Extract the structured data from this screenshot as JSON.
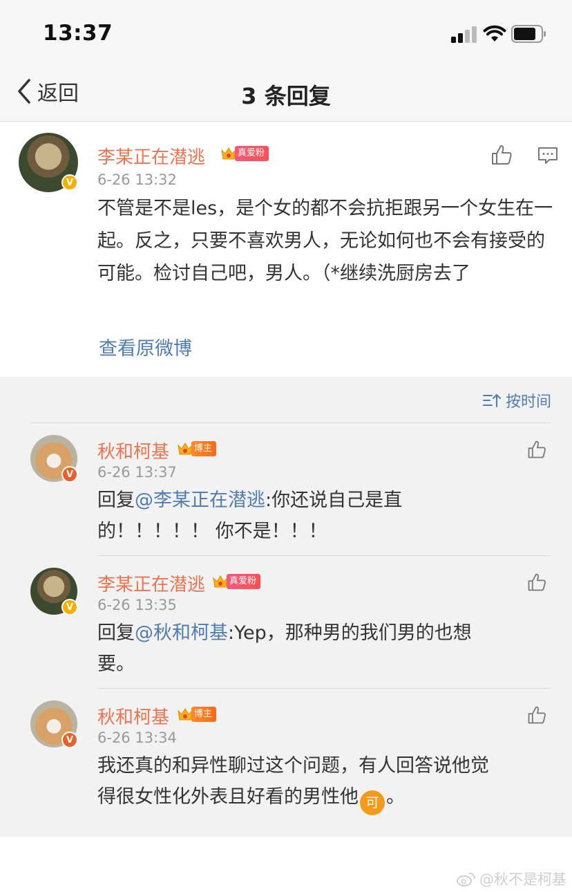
{
  "status_bar": {
    "time": "13:37"
  },
  "nav": {
    "back_label": "返回",
    "title": "3 条回复"
  },
  "main_comment": {
    "username": "李某正在潜逃",
    "badge": "真爱粉",
    "timestamp": "6-26 13:32",
    "text": "不管是不是les，是个女的都不会抗拒跟另一个女生在一起。反之，只要不喜欢男人，无论如何也不会有接受的可能。检讨自己吧，男人。（*继续洗厨房去了",
    "view_original": "查看原微博"
  },
  "sort_label": "按时间",
  "replies": [
    {
      "username": "秋和柯基",
      "badge": "博主",
      "timestamp": "6-26 13:37",
      "reply_prefix": "回复",
      "mention": "@李某正在潜逃",
      "text_line1": ":你还说自己是直",
      "text_line2": "的！！！！！ 你不是！！！"
    },
    {
      "username": "李某正在潜逃",
      "badge": "真爱粉",
      "timestamp": "6-26 13:35",
      "reply_prefix": "回复",
      "mention": "@秋和柯基",
      "text_line1": ":Yep，那种男的我们男的也想",
      "text_line2": "要。"
    },
    {
      "username": "秋和柯基",
      "badge": "博主",
      "timestamp": "6-26 13:34",
      "text_line1": "我还真的和异性聊过这个问题，有人回答说他觉",
      "text_line2_a": "得很女性化外表且好看的男性他",
      "emoji": "可",
      "text_line2_b": "。"
    }
  ],
  "watermark": "@秋不是柯基",
  "colors": {
    "username": "#eb7350",
    "link": "#507daf",
    "timestamp": "#999999"
  }
}
